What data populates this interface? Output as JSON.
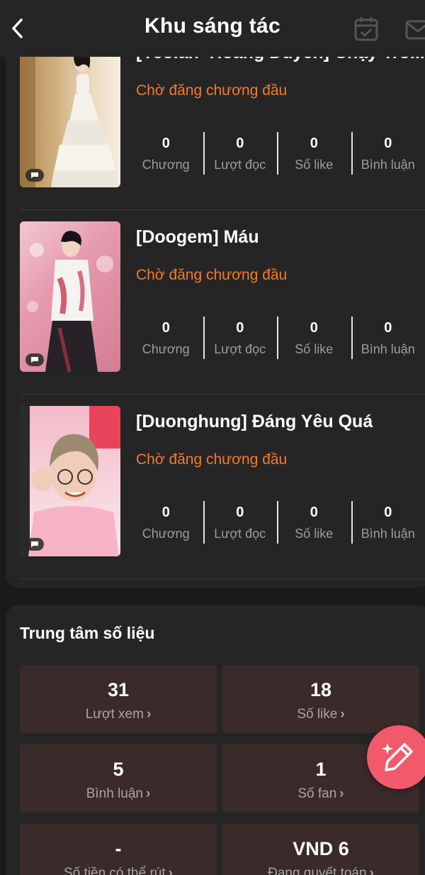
{
  "header": {
    "title": "Khu sáng tác",
    "back_icon": "chevron-left-icon",
    "calendar_icon": "calendar-check-icon",
    "mail_icon": "mail-icon"
  },
  "works": [
    {
      "title": "[Yeolan×Hoàng Duyên] Chạy Trố...",
      "status": "Chờ đăng chương đầu",
      "stats": [
        {
          "value": "0",
          "label": "Chương"
        },
        {
          "value": "0",
          "label": "Lượt đọc"
        },
        {
          "value": "0",
          "label": "Số like"
        },
        {
          "value": "0",
          "label": "Bình luận"
        }
      ]
    },
    {
      "title": "[Doogem] Máu",
      "status": "Chờ đăng chương đầu",
      "stats": [
        {
          "value": "0",
          "label": "Chương"
        },
        {
          "value": "0",
          "label": "Lượt đọc"
        },
        {
          "value": "0",
          "label": "Số like"
        },
        {
          "value": "0",
          "label": "Bình luận"
        }
      ]
    },
    {
      "title": "[Duonghung] Đáng Yêu Quá",
      "status": "Chờ đăng chương đầu",
      "stats": [
        {
          "value": "0",
          "label": "Chương"
        },
        {
          "value": "0",
          "label": "Lượt đọc"
        },
        {
          "value": "0",
          "label": "Số like"
        },
        {
          "value": "0",
          "label": "Bình luận"
        }
      ]
    }
  ],
  "data_center": {
    "title": "Trung tâm số liệu",
    "tiles": [
      {
        "value": "31",
        "label": "Lượt xem"
      },
      {
        "value": "18",
        "label": "Số like"
      },
      {
        "value": "5",
        "label": "Bình luận"
      },
      {
        "value": "1",
        "label": "Số fan"
      },
      {
        "value": "-",
        "label": "Số tiền có thể rút"
      },
      {
        "value": "VND 6",
        "label": "Đang quyết toán"
      }
    ]
  },
  "fab": {
    "icon": "pencil-sparkle-icon"
  },
  "colors": {
    "background": "#1a1a1a",
    "card": "#252525",
    "tile": "#3a2a2a",
    "status": "#f47a2a",
    "fab": "#f25a6b"
  }
}
